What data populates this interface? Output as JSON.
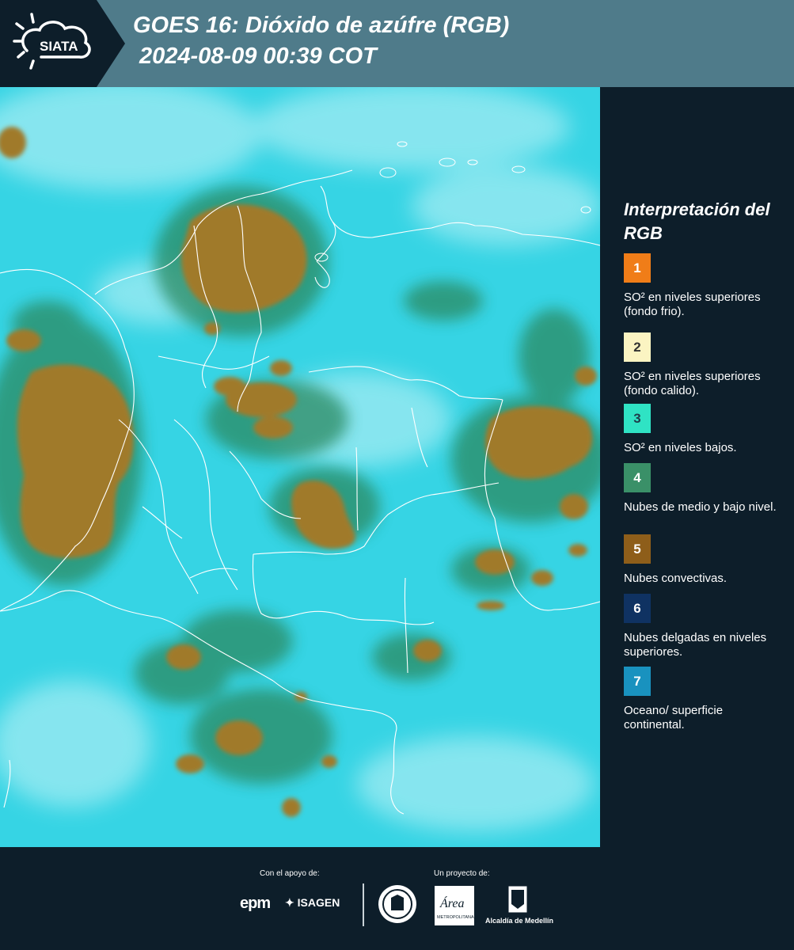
{
  "header": {
    "title_line1": "GOES 16: Dióxido de azúfre (RGB)",
    "title_line2": " 2024-08-09 00:39 COT",
    "logo_text": "SIATA"
  },
  "legend": {
    "title": "Interpretación del RGB",
    "items": [
      {
        "number": "1",
        "label": "SO² en niveles superiores (fondo frio).",
        "color": "#f07d18",
        "text_color": "#ffffff"
      },
      {
        "number": "2",
        "label": "SO² en niveles superiores (fondo calido).",
        "color": "#fbf4c2",
        "text_color": "#333333"
      },
      {
        "number": "3",
        "label": "SO² en niveles bajos.",
        "color": "#2fe3c4",
        "text_color": "#1f3c4a"
      },
      {
        "number": "4",
        "label": "Nubes de medio y bajo nivel.",
        "color": "#3a9068",
        "text_color": "#ffffff"
      },
      {
        "number": "5",
        "label": "Nubes convectivas.",
        "color": "#8e5e1a",
        "text_color": "#ffffff"
      },
      {
        "number": "6",
        "label": "Nubes delgadas en niveles superiores.",
        "color": "#0f3262",
        "text_color": "#ffffff"
      },
      {
        "number": "7",
        "label": "Oceano/ superficie continental.",
        "color": "#1992bf",
        "text_color": "#ffffff"
      }
    ]
  },
  "map": {
    "background_color": "#36d4e4",
    "convective_color": "#a07a2c",
    "mid_cloud_color": "#2a8a62",
    "thin_cloud_color": "#c8f4f8",
    "boundary_color": "#ffffff"
  },
  "footer": {
    "support_caption": "Con el apoyo de:",
    "project_caption": "Un proyecto de:",
    "epm_logo": "epm",
    "isagen_logo": "ISAGEN",
    "area_logo": "Área",
    "area_logo_sub": "METROPOLITANA",
    "alcaldia_logo": "Alcaldía de Medellín"
  }
}
